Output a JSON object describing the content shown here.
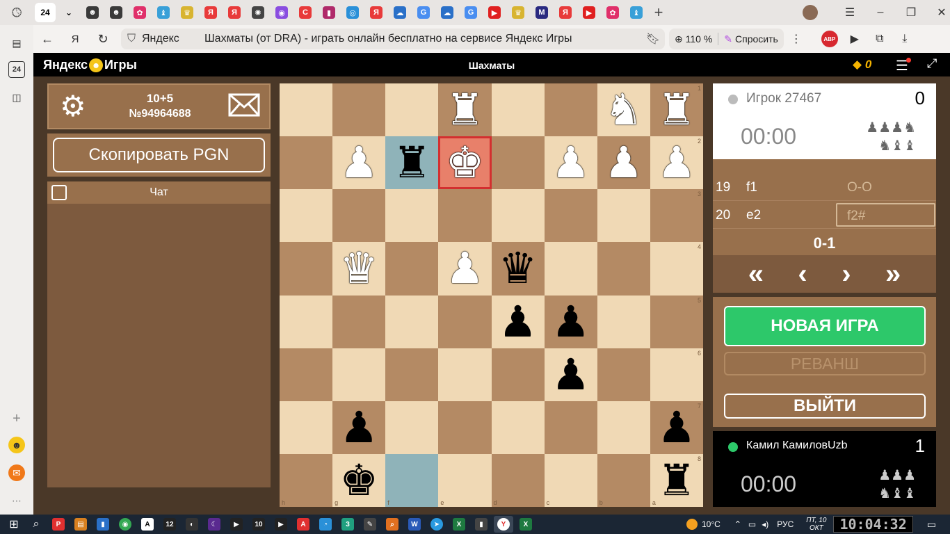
{
  "browser": {
    "active_tab_badge": "24",
    "tabs": [
      {
        "icon": "face-icon",
        "color": "#3a3a3a",
        "glyph": "☻"
      },
      {
        "icon": "face-icon",
        "color": "#3a3a3a",
        "glyph": "☻"
      },
      {
        "icon": "flower-icon",
        "color": "#e0306a",
        "glyph": "✿"
      },
      {
        "icon": "chess-icon",
        "color": "#39a0d8",
        "glyph": "♝"
      },
      {
        "icon": "crown-icon",
        "color": "#d8b430",
        "glyph": "♛"
      },
      {
        "icon": "yandex-icon",
        "color": "#e83a3a",
        "glyph": "Я"
      },
      {
        "icon": "yandex-icon",
        "color": "#e83a3a",
        "glyph": "Я"
      },
      {
        "icon": "openai-icon",
        "color": "#444444",
        "glyph": "✺"
      },
      {
        "icon": "purple-icon",
        "color": "#8a4de0",
        "glyph": "◉"
      },
      {
        "icon": "red-c-icon",
        "color": "#e83a3a",
        "glyph": "C"
      },
      {
        "icon": "audio-icon",
        "color": "#b02a6a",
        "glyph": "▮"
      },
      {
        "icon": "target-icon",
        "color": "#2a90d8",
        "glyph": "◎"
      },
      {
        "icon": "yandex-icon",
        "color": "#e83a3a",
        "glyph": "Я"
      },
      {
        "icon": "cloud-icon",
        "color": "#2a70c8",
        "glyph": "☁"
      },
      {
        "icon": "translate-icon",
        "color": "#4a8ef0",
        "glyph": "G"
      },
      {
        "icon": "cloud-icon",
        "color": "#2a70c8",
        "glyph": "☁"
      },
      {
        "icon": "translate-icon",
        "color": "#4a8ef0",
        "glyph": "G"
      },
      {
        "icon": "youtube-icon",
        "color": "#e02020",
        "glyph": "▶"
      },
      {
        "icon": "crown-icon",
        "color": "#d8b430",
        "glyph": "♛"
      },
      {
        "icon": "m-icon",
        "color": "#2a2a80",
        "glyph": "M"
      },
      {
        "icon": "yandex-icon",
        "color": "#e83a3a",
        "glyph": "Я"
      },
      {
        "icon": "youtube-icon",
        "color": "#e02020",
        "glyph": "▶"
      },
      {
        "icon": "flower-icon",
        "color": "#e0306a",
        "glyph": "✿"
      },
      {
        "icon": "chess-icon",
        "color": "#39a0d8",
        "glyph": "♝"
      }
    ],
    "site_name": "Яндекс",
    "page_title": "Шахматы (от DRA) - играть онлайн бесплатно на сервисе Яндекс Игры",
    "zoom": "110 %",
    "ask_label": "Спросить",
    "abp_label": "ABP"
  },
  "sidepanel": {
    "badge": "24"
  },
  "header": {
    "logo_left": "Яндекс",
    "logo_right": "Игры",
    "title": "Шахматы",
    "coins": "0"
  },
  "left": {
    "time_control": "10+5",
    "game_id": "№94964688",
    "copy_pgn": "Скопировать PGN",
    "chat_label": "Чат"
  },
  "board": {
    "rows": [
      [
        "",
        "",
        "",
        "wR",
        "",
        "",
        "wN",
        "wR"
      ],
      [
        "",
        "wP",
        "bR",
        "wK",
        "",
        "wP",
        "wP",
        "wP"
      ],
      [
        "",
        "",
        "",
        "",
        "",
        "",
        "",
        ""
      ],
      [
        "",
        "wQ",
        "",
        "wP",
        "bQ",
        "",
        "",
        ""
      ],
      [
        "",
        "",
        "",
        "",
        "bP",
        "bP",
        "",
        ""
      ],
      [
        "",
        "",
        "",
        "",
        "",
        "bP",
        "",
        ""
      ],
      [
        "",
        "bP",
        "",
        "",
        "",
        "",
        "",
        "bP"
      ],
      [
        "",
        "bK",
        "",
        "",
        "",
        "",
        "",
        "bR"
      ]
    ],
    "rank_labels": [
      "1",
      "2",
      "3",
      "4",
      "5",
      "6",
      "7",
      "8"
    ],
    "file_labels": [
      "h",
      "g",
      "f",
      "e",
      "d",
      "c",
      "b",
      "a"
    ],
    "highlight": [
      [
        1,
        2
      ],
      [
        7,
        2
      ]
    ],
    "check": [
      1,
      3
    ]
  },
  "top_player": {
    "name": "Игрок 27467",
    "score": "0",
    "time": "00:00",
    "captured_row1": "♟♟♟♞",
    "captured_row2": "♞♝♝"
  },
  "moves": {
    "rows": [
      {
        "num": "19",
        "white": "f1",
        "black": "O-O"
      },
      {
        "num": "20",
        "white": "e2",
        "black": "f2#"
      }
    ],
    "result": "0-1"
  },
  "nav": {
    "first": "«",
    "prev": "‹",
    "next": "›",
    "last": "»"
  },
  "actions": {
    "new_game": "НОВАЯ ИГРА",
    "rematch": "РЕВАНШ",
    "exit": "ВЫЙТИ"
  },
  "bottom_player": {
    "name": "Камил КамиловUzb",
    "score": "1",
    "time": "00:00",
    "captured_row1": "♟♟♟",
    "captured_row2": "♞♝♝"
  },
  "taskbar": {
    "temperature": "10°C",
    "lang": "РУС",
    "date_line1": "ПТ, 10",
    "date_line2": "ОКТ",
    "time": "10:04:32"
  }
}
